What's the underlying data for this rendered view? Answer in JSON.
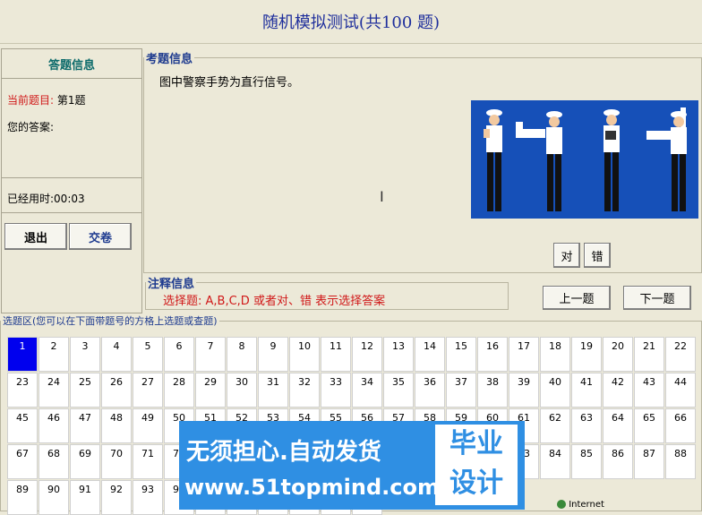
{
  "header": {
    "title": "随机模拟测试(共100 题)"
  },
  "left": {
    "title": "答题信息",
    "current_label": "当前题目:",
    "current_value": "第1题",
    "answer_label": "您的答案:",
    "time_label": "已经用时:",
    "time_value": "00:03",
    "exit_label": "退出",
    "submit_label": "交卷"
  },
  "question": {
    "legend": "考题信息",
    "text": "图中警察手势为直行信号。",
    "true_label": "对",
    "false_label": "错"
  },
  "note": {
    "legend": "注释信息",
    "text": "选择题: A,B,C,D 或者对、错 表示选择答案"
  },
  "nav": {
    "prev_label": "上一题",
    "next_label": "下一题"
  },
  "selector": {
    "legend": "选题区(您可以在下面带题号的方格上选题或查题)"
  },
  "numbers": [
    "1",
    "2",
    "3",
    "4",
    "5",
    "6",
    "7",
    "8",
    "9",
    "10",
    "11",
    "12",
    "13",
    "14",
    "15",
    "16",
    "17",
    "18",
    "19",
    "20",
    "21",
    "22",
    "23",
    "24",
    "25",
    "26",
    "27",
    "28",
    "29",
    "30",
    "31",
    "32",
    "33",
    "34",
    "35",
    "36",
    "37",
    "38",
    "39",
    "40",
    "41",
    "42",
    "43",
    "44",
    "45",
    "46",
    "47",
    "48",
    "49",
    "50",
    "51",
    "52",
    "53",
    "54",
    "55",
    "56",
    "57",
    "58",
    "59",
    "60",
    "61",
    "62",
    "63",
    "64",
    "65",
    "66",
    "67",
    "68",
    "69",
    "70",
    "71",
    "72",
    "73",
    "74",
    "75",
    "76",
    "77",
    "78",
    "79",
    "80",
    "81",
    "82",
    "83",
    "84",
    "85",
    "86",
    "87",
    "88",
    "89",
    "90",
    "91",
    "92",
    "93",
    "94",
    "95",
    "96",
    "97",
    "98",
    "99",
    "100"
  ],
  "selected": "1",
  "watermark": {
    "line1": "无须担心.自动发货",
    "line2": "www.51topmind.com",
    "badge1": "毕业",
    "badge2": "设计"
  },
  "statusbar": {
    "zone": "Internet"
  },
  "colors": {
    "accent": "#1f2f9c",
    "selected_cell": "#0000ee",
    "question_bg": "#1650b8"
  }
}
